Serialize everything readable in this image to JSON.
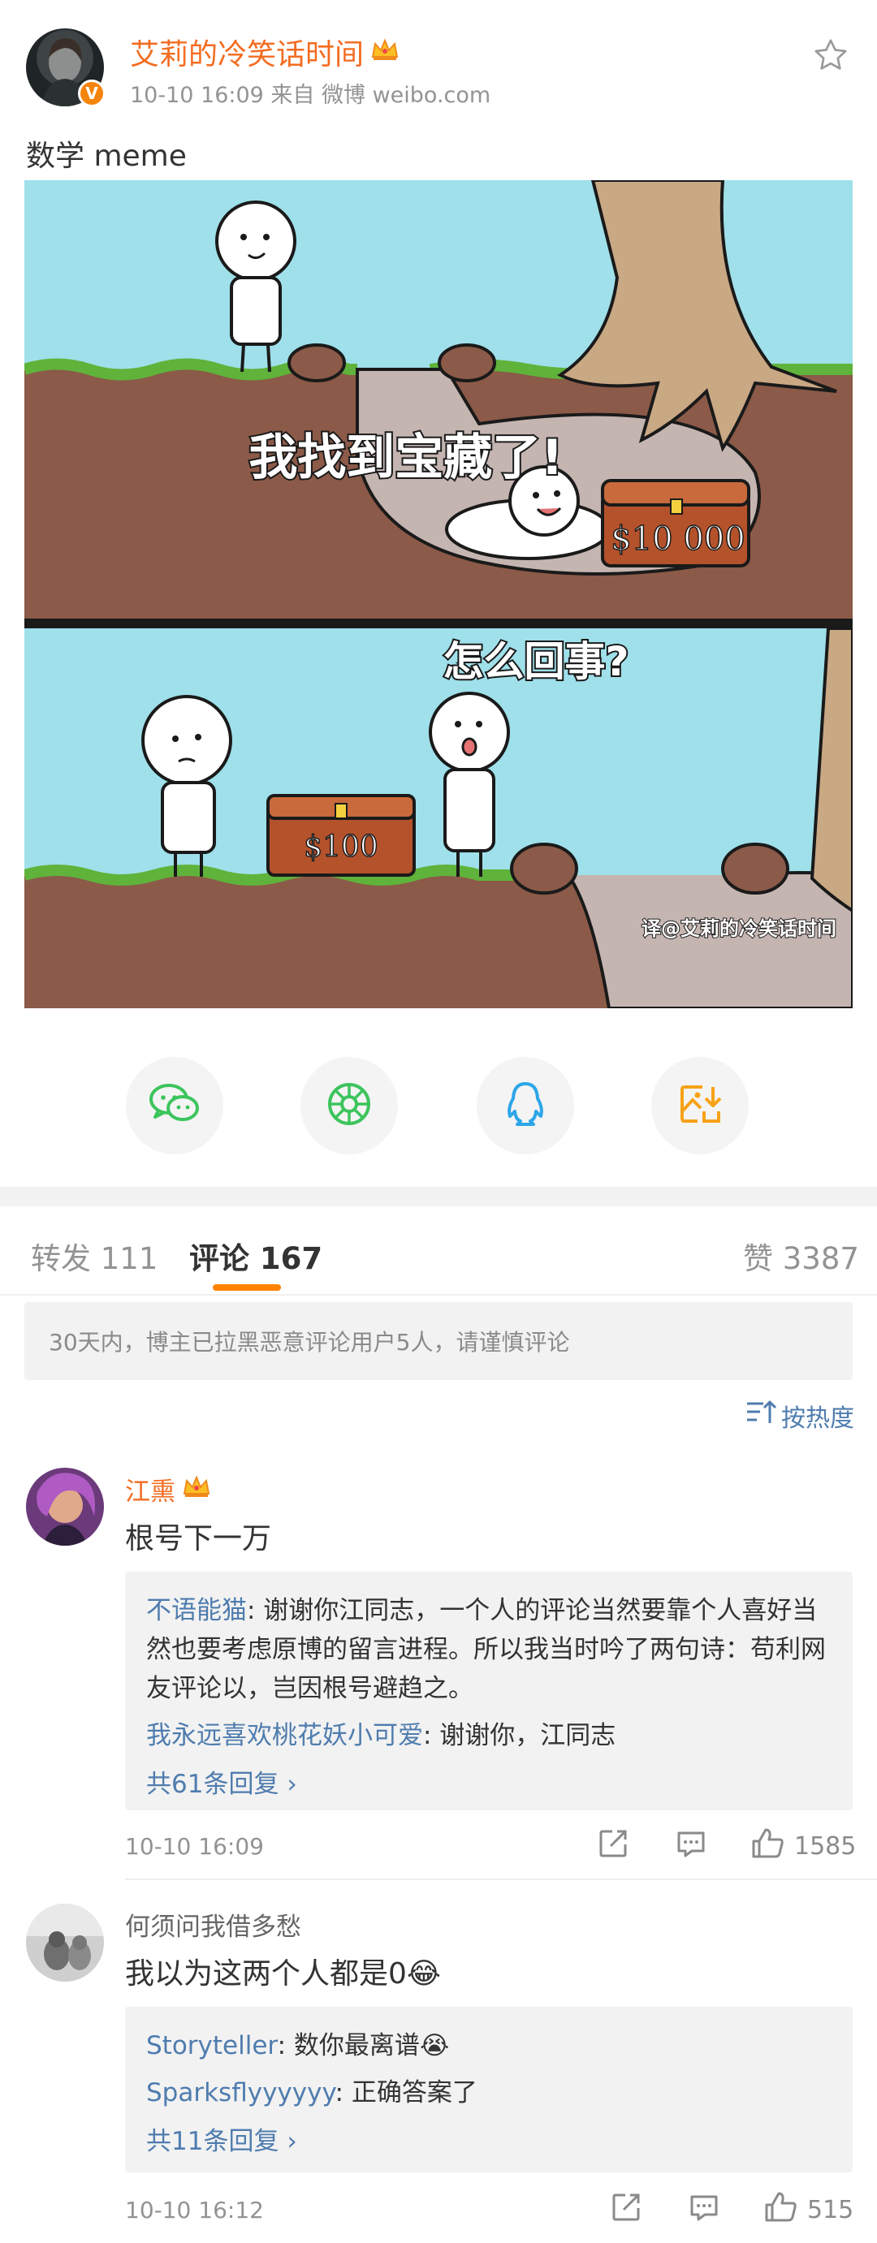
{
  "post": {
    "author": "艾莉的冷笑话时间",
    "verified_badge": "V",
    "meta": "10-10 16:09   来自 微博 weibo.com",
    "text": "数学 meme",
    "image": {
      "panel1_caption": "我找到宝藏了!",
      "panel1_chest_label": "$10 000",
      "panel2_caption": "怎么回事?",
      "panel2_chest_label": "$100",
      "watermark": "译@艾莉的冷笑话时间"
    }
  },
  "share_icons": [
    "wechat-icon",
    "moments-icon",
    "qq-icon",
    "save-image-icon"
  ],
  "tabs": {
    "repost": "转发 111",
    "comment": "评论 167",
    "like": "赞 3387"
  },
  "notice": "30天内，博主已拉黑恶意评论用户5人，请谨慎评论",
  "sort_label": "按热度",
  "comments": [
    {
      "name": "江熏",
      "text": "根号下一万",
      "replies": [
        {
          "user": "不语能猫",
          "text": ": 谢谢你江同志，一个人的评论当然要靠个人喜好当然也要考虑原博的留言进程。所以我当时吟了两句诗：苟利网友评论以，岂因根号避趋之。"
        },
        {
          "user": "我永远喜欢桃花妖小可爱",
          "text": ": 谢谢你，江同志"
        }
      ],
      "more": "共61条回复",
      "time": "10-10 16:09",
      "likes": "1585"
    },
    {
      "name": "何须问我借多愁",
      "text": "我以为这两个人都是0",
      "text_emoji": "😂",
      "replies": [
        {
          "user": "Storyteller",
          "text": ": 数你最离谱",
          "emoji": "😭"
        },
        {
          "user": "Sparksflyyyyyy",
          "text": ": 正确答案了"
        }
      ],
      "more": "共11条回复",
      "time": "10-10 16:12",
      "likes": "515"
    }
  ],
  "colors": {
    "accent_orange": "#ff8200",
    "author_orange": "#f36c21",
    "link_blue": "#4f7cae",
    "wechat_green": "#3cc45c",
    "qq_blue": "#2ca6e8",
    "save_orange": "#f7a218",
    "sky": "#9fe0ea",
    "dirt": "#8b5a48"
  }
}
